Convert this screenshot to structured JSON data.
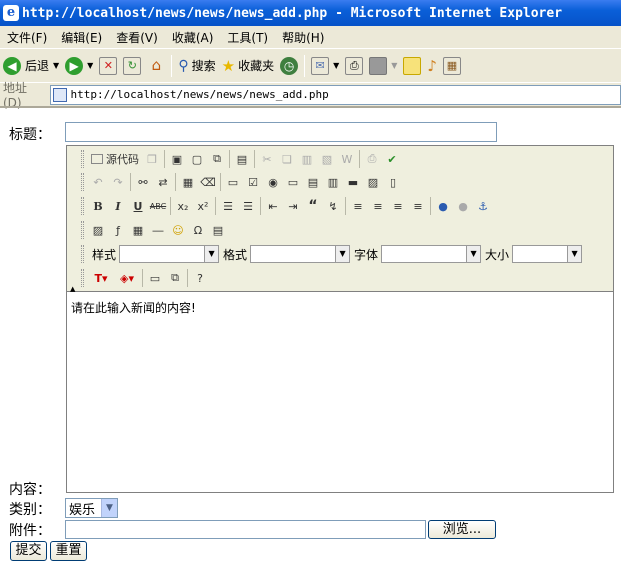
{
  "window": {
    "title": "http://localhost/news/news/news_add.php - Microsoft Internet Explorer"
  },
  "menu": [
    "文件(F)",
    "编辑(E)",
    "查看(V)",
    "收藏(A)",
    "工具(T)",
    "帮助(H)"
  ],
  "toolbar": {
    "back": "后退",
    "search": "搜索",
    "favorites": "收藏夹"
  },
  "address": {
    "label": "地址(D)",
    "url": "http://localhost/news/news/news_add.php"
  },
  "form": {
    "title_label": "标题：",
    "title_value": "",
    "content_label": "内容：",
    "category_label": "类别：",
    "category_value": "娱乐",
    "attachment_label": "附件：",
    "browse_label": "浏览...",
    "submit_label": "提交",
    "reset_label": "重置"
  },
  "editor": {
    "source_label": "源代码",
    "style_label": "样式",
    "format_label": "格式",
    "font_label": "字体",
    "size_label": "大小",
    "content": "请在此输入新闻的内容!"
  }
}
